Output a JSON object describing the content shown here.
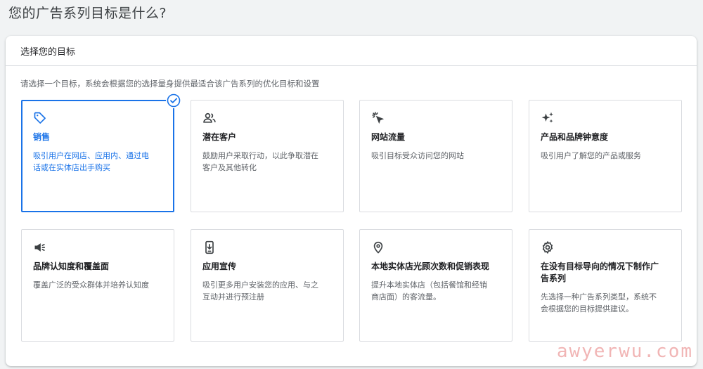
{
  "page": {
    "title": "您的广告系列目标是什么?"
  },
  "panel": {
    "header": "选择您的目标",
    "instruction": "请选择一个目标，系统会根据您的选择量身提供最适合该广告系列的优化目标和设置"
  },
  "goals": [
    {
      "icon": "tag-icon",
      "title": "销售",
      "desc_lines": [
        "吸引用户在网店、应用内、通过电",
        "话或在实体店出手购买"
      ],
      "selected": true
    },
    {
      "icon": "people-icon",
      "title": "潜在客户",
      "desc_lines": [
        "鼓励用户采取行动，以此争取潜在",
        "客户及其他转化"
      ],
      "selected": false
    },
    {
      "icon": "cursor-click-icon",
      "title": "网站流量",
      "desc_lines": [
        "吸引目标受众访问您的网站"
      ],
      "selected": false
    },
    {
      "icon": "sparkle-icon",
      "title": "产品和品牌钟意度",
      "desc_lines": [
        "吸引用户了解您的产品或服务"
      ],
      "selected": false
    },
    {
      "icon": "megaphone-icon",
      "title": "品牌认知度和覆盖面",
      "desc_lines": [
        "覆盖广泛的受众群体并培养认知度"
      ],
      "selected": false
    },
    {
      "icon": "phone-download-icon",
      "title": "应用宣传",
      "desc_lines": [
        "吸引更多用户安装您的应用、与之",
        "互动并进行预注册"
      ],
      "selected": false
    },
    {
      "icon": "location-pin-icon",
      "title": "本地实体店光顾次数和促销表现",
      "desc_lines": [
        "提升本地实体店（包括餐馆和经销",
        "商店面）的客流量。"
      ],
      "selected": false
    },
    {
      "icon": "gear-icon",
      "title_lines": [
        "在没有目标导向的情况下制作广",
        "告系列"
      ],
      "desc_lines": [
        "先选择一种广告系列类型，系统不",
        "会根据您的目标提供建议。"
      ],
      "selected": false
    }
  ],
  "watermark": "awyerwu.com",
  "colors": {
    "accent": "#1a73e8",
    "border": "#dadce0",
    "text_secondary": "#5f6368"
  }
}
